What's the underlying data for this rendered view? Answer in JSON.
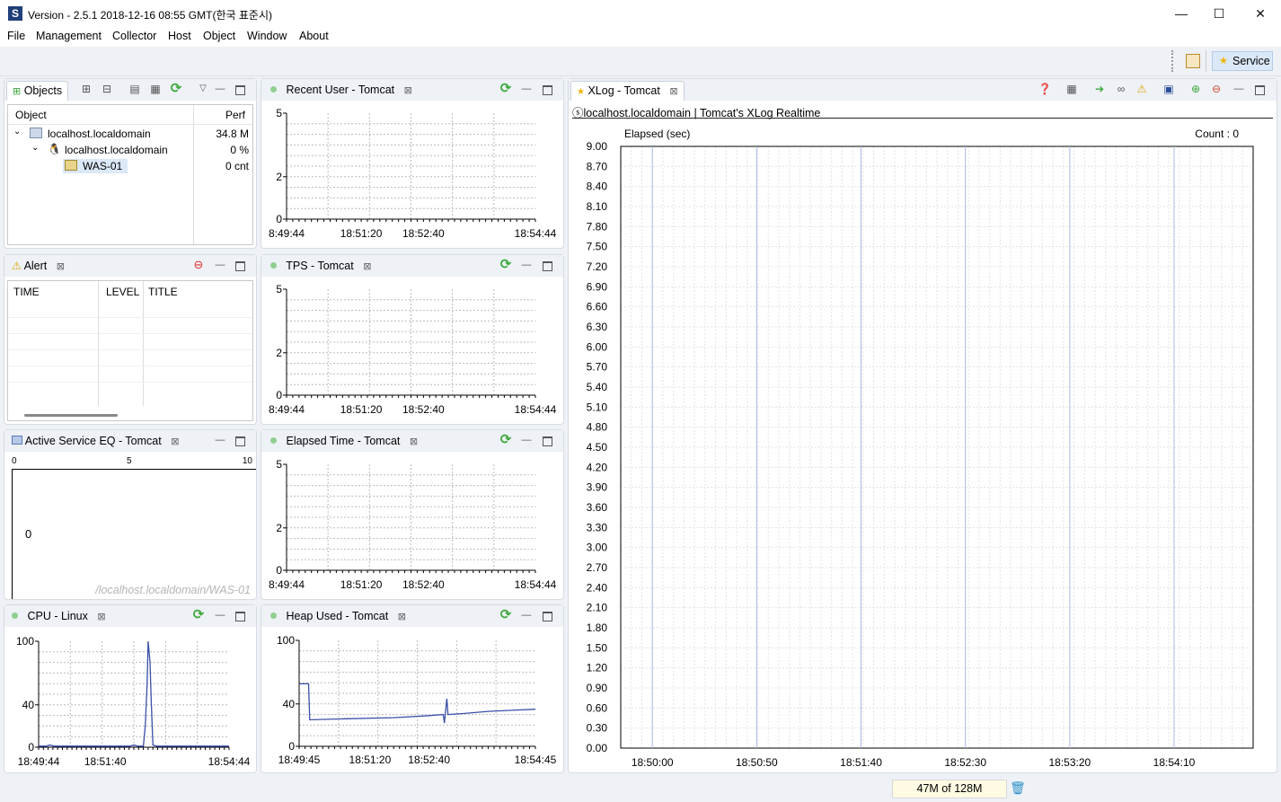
{
  "window": {
    "title": "Version - 2.5.1 2018-12-16 08:55 GMT(한국 표준시)",
    "minimize": "—",
    "maximize": "☐",
    "close": "✕"
  },
  "menu": [
    "File",
    "Management",
    "Collector",
    "Host",
    "Object",
    "Window",
    "About"
  ],
  "toolbar": {
    "service_label": "Service"
  },
  "objects": {
    "tab": "Objects",
    "col_object": "Object",
    "col_perf": "Perf",
    "rows": [
      {
        "name": "localhost.localdomain",
        "perf": "34.8 M"
      },
      {
        "name": "localhost.localdomain",
        "perf": "0 %"
      },
      {
        "name": "WAS-01",
        "perf": "0 cnt"
      }
    ]
  },
  "alert": {
    "tab": "Alert",
    "cols": [
      "TIME",
      "LEVEL",
      "TITLE"
    ]
  },
  "active_service": {
    "tab": "Active Service EQ - Tomcat",
    "scale": [
      "0",
      "5",
      "10"
    ],
    "count": "0",
    "path": "/localhost.localdomain/WAS-01"
  },
  "recent_user": {
    "tab": "Recent User - Tomcat"
  },
  "tps": {
    "tab": "TPS - Tomcat"
  },
  "elapsed_time": {
    "tab": "Elapsed Time - Tomcat"
  },
  "cpu": {
    "tab": "CPU - Linux"
  },
  "heap": {
    "tab": "Heap Used - Tomcat"
  },
  "xlog": {
    "tab": "XLog - Tomcat",
    "subtitle": "ⓢlocalhost.localdomain | Tomcat's XLog Realtime",
    "ylabel": "Elapsed (sec)",
    "count": "Count : 0"
  },
  "status": {
    "memory": "47M of 128M"
  },
  "colors": {
    "accent": "#3a4fa8",
    "grid": "#c8c8c8",
    "refresh": "#3aa83a"
  },
  "chart_data": [
    {
      "id": "recent_user",
      "type": "line",
      "title": "Recent User - Tomcat",
      "ylim": [
        0,
        5
      ],
      "yticks": [
        "0",
        "2",
        "5"
      ],
      "xticks": [
        "8:49:44",
        "18:51:20",
        "18:52:40",
        "18:54:44"
      ],
      "series": []
    },
    {
      "id": "tps",
      "type": "line",
      "title": "TPS - Tomcat",
      "ylim": [
        0,
        5
      ],
      "yticks": [
        "0",
        "2",
        "5"
      ],
      "xticks": [
        "8:49:44",
        "18:51:20",
        "18:52:40",
        "18:54:44"
      ],
      "series": []
    },
    {
      "id": "elapsed_time",
      "type": "line",
      "title": "Elapsed Time - Tomcat",
      "ylim": [
        0,
        5
      ],
      "yticks": [
        "0",
        "2",
        "5"
      ],
      "xticks": [
        "8:49:44",
        "18:51:20",
        "18:52:40",
        "18:54:44"
      ],
      "series": []
    },
    {
      "id": "cpu",
      "type": "line",
      "title": "CPU - Linux",
      "ylim": [
        0,
        100
      ],
      "yticks": [
        "0",
        "40",
        "100"
      ],
      "xticks": [
        "18:49:44",
        "18:51:40",
        "18:54:44"
      ],
      "series": [
        {
          "values": [
            [
              0.0,
              1
            ],
            [
              0.04,
              1
            ],
            [
              0.06,
              2
            ],
            [
              0.08,
              1
            ],
            [
              0.2,
              1
            ],
            [
              0.3,
              1
            ],
            [
              0.36,
              1
            ],
            [
              0.42,
              1
            ],
            [
              0.44,
              1
            ],
            [
              0.48,
              1
            ],
            [
              0.5,
              2
            ],
            [
              0.52,
              1
            ],
            [
              0.55,
              1
            ],
            [
              0.56,
              20
            ],
            [
              0.57,
              60
            ],
            [
              0.575,
              100
            ],
            [
              0.585,
              80
            ],
            [
              0.59,
              50
            ],
            [
              0.6,
              2
            ],
            [
              0.62,
              1
            ],
            [
              0.65,
              1
            ],
            [
              0.75,
              1
            ],
            [
              0.85,
              1
            ],
            [
              1.0,
              1
            ]
          ]
        }
      ]
    },
    {
      "id": "heap",
      "type": "line",
      "title": "Heap Used - Tomcat",
      "ylim": [
        0,
        100
      ],
      "yticks": [
        "0",
        "40",
        "100"
      ],
      "xticks": [
        "18:49:45",
        "18:51:20",
        "18:52:40",
        "18:54:45"
      ],
      "series": [
        {
          "values": [
            [
              0.0,
              59
            ],
            [
              0.04,
              59
            ],
            [
              0.045,
              25
            ],
            [
              0.2,
              26
            ],
            [
              0.4,
              27
            ],
            [
              0.55,
              29
            ],
            [
              0.61,
              30
            ],
            [
              0.615,
              22
            ],
            [
              0.625,
              45
            ],
            [
              0.63,
              30
            ],
            [
              0.7,
              31
            ],
            [
              0.8,
              33
            ],
            [
              0.9,
              34
            ],
            [
              1.0,
              35
            ]
          ]
        }
      ]
    },
    {
      "id": "xlog",
      "type": "scatter",
      "title": "Tomcat's XLog Realtime",
      "ylabel": "Elapsed (sec)",
      "ylim": [
        0,
        9
      ],
      "yticks": [
        "0.00",
        "0.30",
        "0.60",
        "0.90",
        "1.20",
        "1.50",
        "1.80",
        "2.10",
        "2.40",
        "2.70",
        "3.00",
        "3.30",
        "3.60",
        "3.90",
        "4.20",
        "4.50",
        "4.80",
        "5.10",
        "5.40",
        "5.70",
        "6.00",
        "6.30",
        "6.60",
        "6.90",
        "7.20",
        "7.50",
        "7.80",
        "8.10",
        "8.40",
        "8.70",
        "9.00"
      ],
      "xticks": [
        "18:50:00",
        "18:50:50",
        "18:51:40",
        "18:52:30",
        "18:53:20",
        "18:54:10"
      ],
      "points": []
    }
  ]
}
